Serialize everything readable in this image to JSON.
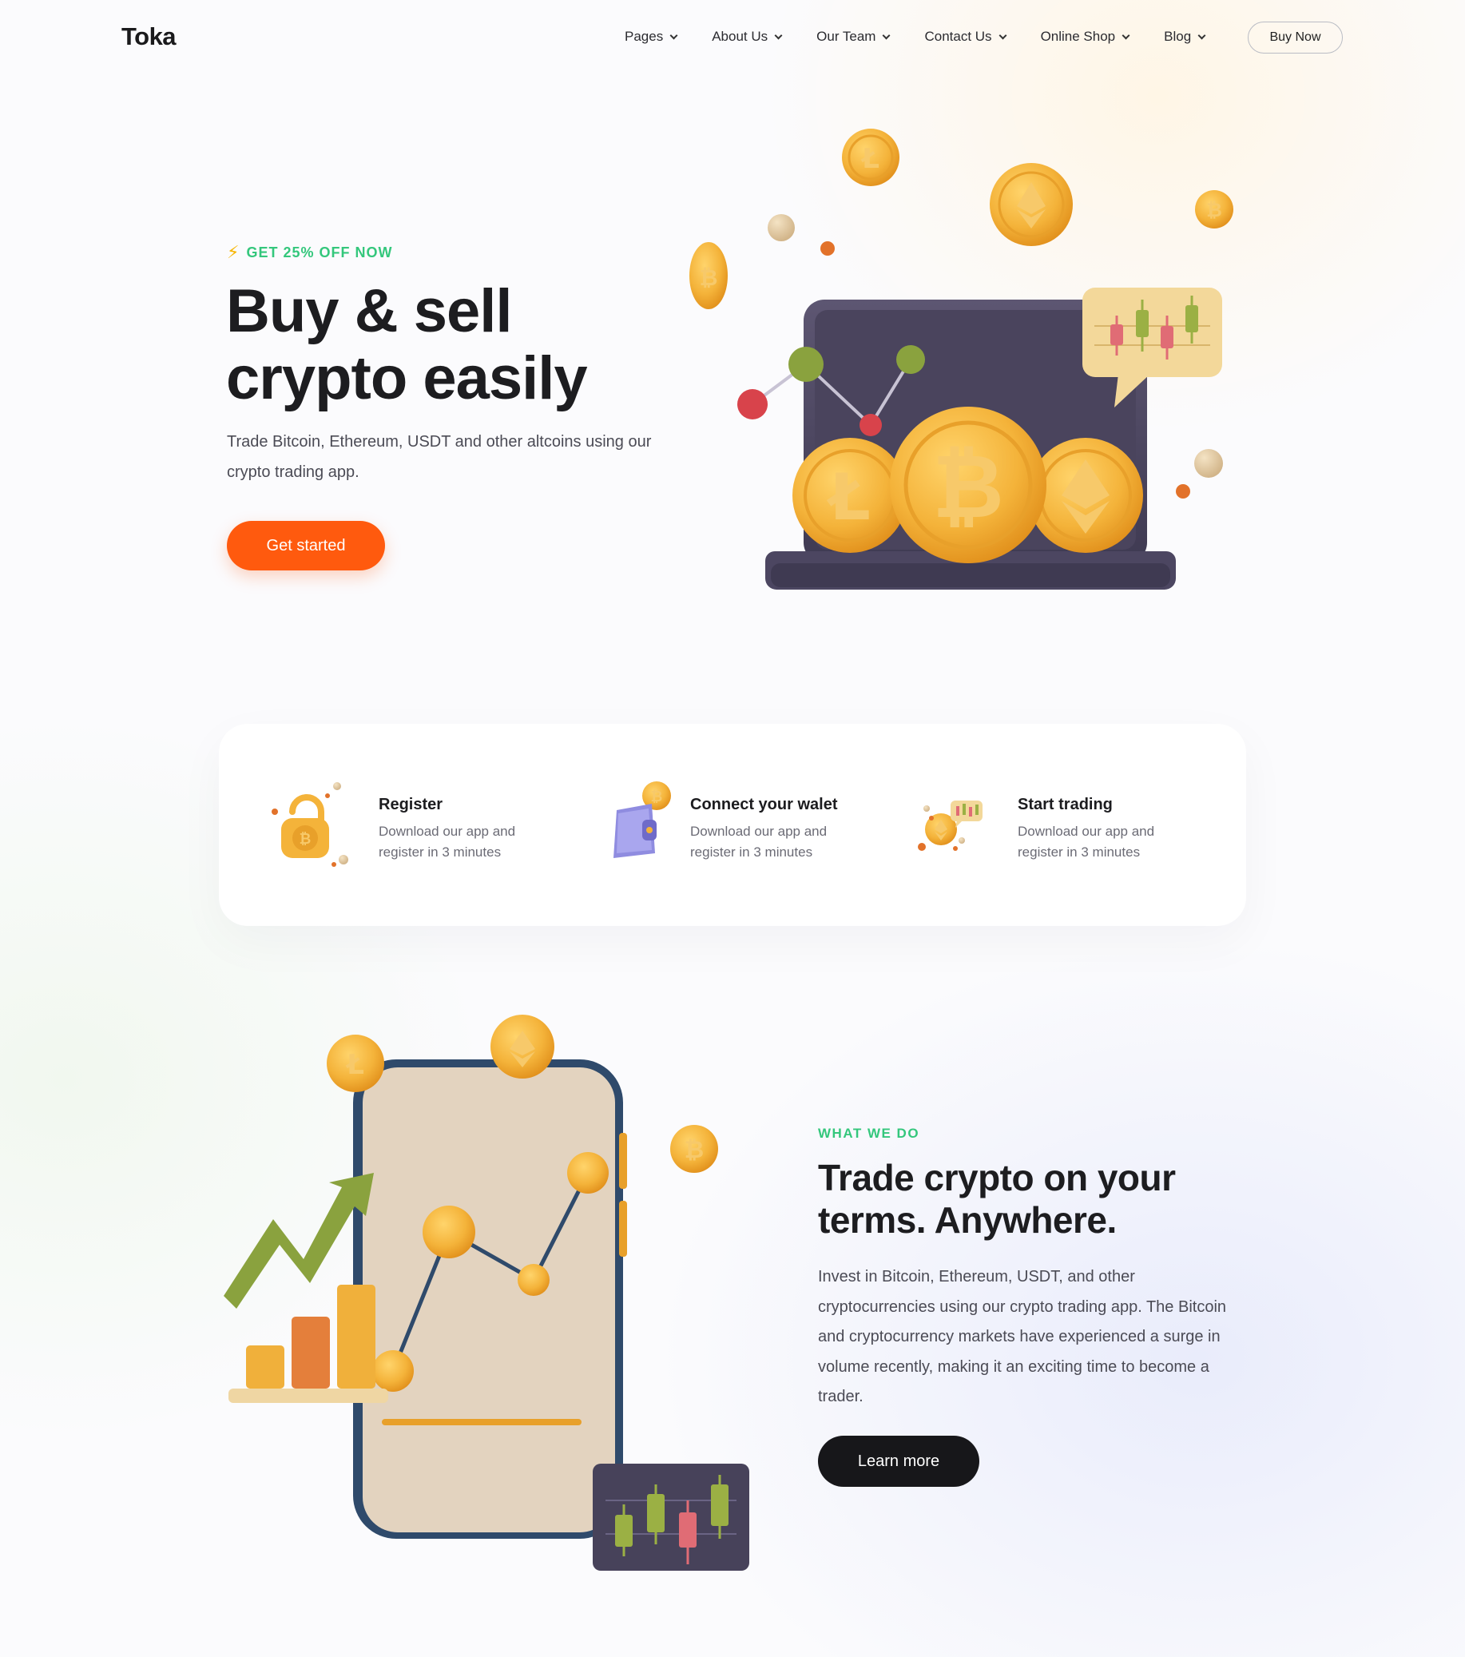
{
  "nav": {
    "logo": "Toka",
    "menu": [
      {
        "label": "Pages"
      },
      {
        "label": "About Us"
      },
      {
        "label": "Our Team"
      },
      {
        "label": "Contact Us"
      },
      {
        "label": "Online Shop"
      },
      {
        "label": "Blog"
      }
    ],
    "buy_now_label": "Buy Now"
  },
  "hero": {
    "promo": "GET 25% OFF NOW",
    "title_line1": "Buy & sell",
    "title_line2": "crypto easily",
    "subtitle": "Trade Bitcoin, Ethereum, USDT and other altcoins using our crypto trading app.",
    "cta_label": "Get started"
  },
  "steps": [
    {
      "title": "Register",
      "desc": "Download our app and register in 3 minutes",
      "icon": "padlock-bitcoin-icon"
    },
    {
      "title": "Connect your walet",
      "desc": "Download our app and register in 3 minutes",
      "icon": "wallet-icon"
    },
    {
      "title": "Start trading",
      "desc": "Download our app and register in 3 minutes",
      "icon": "trading-coin-icon"
    }
  ],
  "what_we_do": {
    "eyebrow": "WHAT WE DO",
    "title": "Trade crypto on your terms. Anywhere.",
    "body": "Invest in Bitcoin, Ethereum, USDT, and other cryptocurrencies using our crypto trading app. The Bitcoin and cryptocurrency markets have experienced a surge in volume recently, making it an exciting time to become a trader.",
    "button_label": "Learn more"
  },
  "colors": {
    "accent_orange": "#ff5a0e",
    "accent_green": "#34c77c",
    "coin_gold": "#f4b33a",
    "dark": "#17171a"
  }
}
